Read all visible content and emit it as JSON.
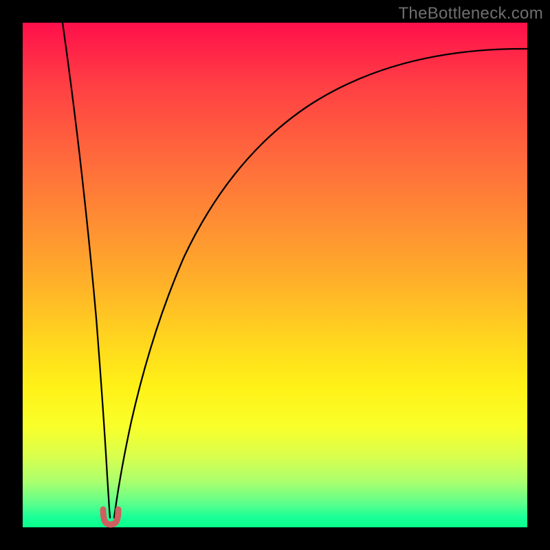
{
  "watermark": "TheBottleneck.com",
  "colors": {
    "background": "#000000",
    "curve": "#000000",
    "cusp_fill": "#cf5f5f",
    "cusp_stroke": "#cf5f5f"
  },
  "chart_data": {
    "type": "line",
    "title": "",
    "xlabel": "",
    "ylabel": "",
    "xlim": [
      0,
      100
    ],
    "ylim": [
      0,
      100
    ],
    "grid": false,
    "legend": false,
    "note": "Heat-map style gradient background (red top, green bottom) with a black curve forming a sharp cusp near x≈17 at y≈0. Left branch rises steeply toward top-left corner; right branch rises asymptotically toward top-right edge. Small pink U-shaped marker at the cusp.",
    "series": [
      {
        "name": "bottleneck-curve",
        "x": [
          0,
          4,
          8,
          12,
          15,
          16,
          17,
          18,
          19,
          21,
          24,
          28,
          33,
          40,
          50,
          62,
          76,
          90,
          100
        ],
        "y": [
          100,
          78,
          56,
          34,
          13,
          6,
          1,
          2,
          6,
          14,
          26,
          40,
          53,
          65,
          76,
          84,
          89,
          92,
          93
        ]
      }
    ],
    "annotations": [
      {
        "name": "cusp-marker",
        "shape": "u",
        "x": 17,
        "y": 0,
        "color": "#cf5f5f"
      }
    ]
  }
}
